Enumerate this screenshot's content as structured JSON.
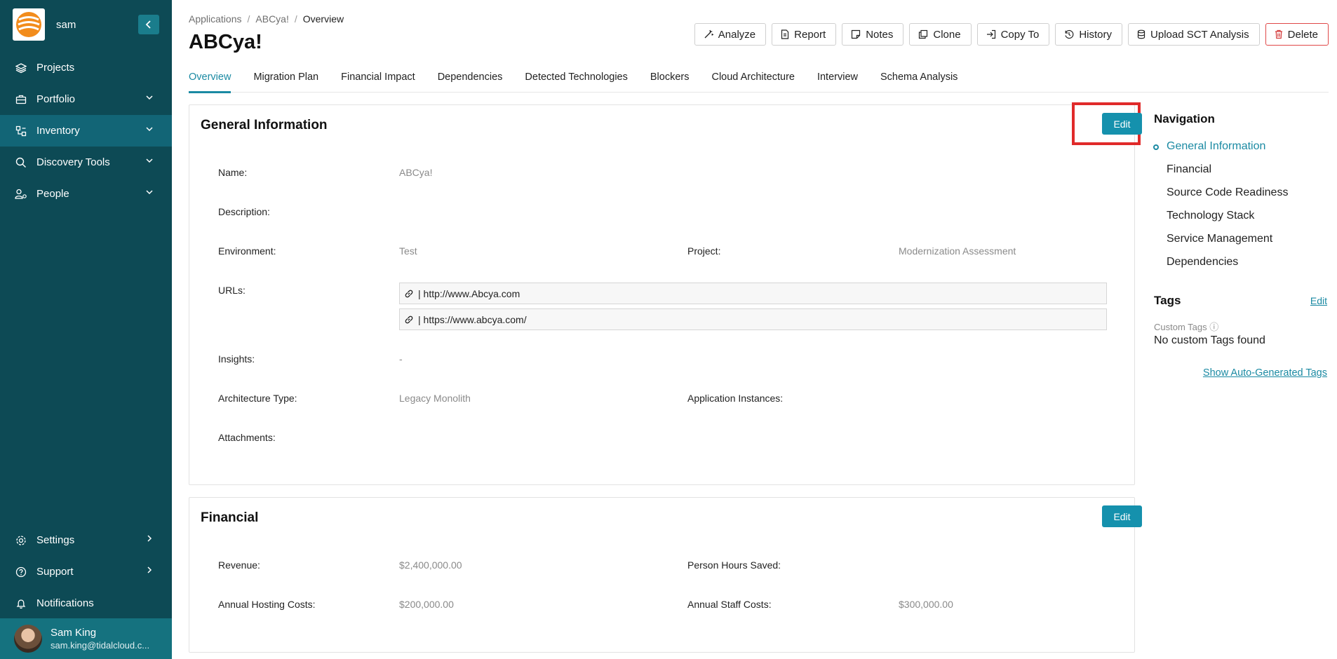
{
  "sidebar": {
    "user_short": "sam",
    "items": [
      {
        "label": "Projects",
        "icon": "layers-icon"
      },
      {
        "label": "Portfolio",
        "icon": "briefcase-icon"
      },
      {
        "label": "Inventory",
        "icon": "inventory-icon"
      },
      {
        "label": "Discovery Tools",
        "icon": "search-icon"
      },
      {
        "label": "People",
        "icon": "people-icon"
      }
    ],
    "bottom_items": [
      {
        "label": "Settings",
        "icon": "gear-icon"
      },
      {
        "label": "Support",
        "icon": "help-icon"
      },
      {
        "label": "Notifications",
        "icon": "bell-icon"
      }
    ],
    "user": {
      "name": "Sam King",
      "email": "sam.king@tidalcloud.c..."
    }
  },
  "breadcrumb": [
    "Applications",
    "ABCya!",
    "Overview"
  ],
  "page": {
    "title": "ABCya!"
  },
  "toolbar": [
    "Analyze",
    "Report",
    "Notes",
    "Clone",
    "Copy To",
    "History",
    "Upload SCT Analysis",
    "Delete"
  ],
  "tabs": [
    "Overview",
    "Migration Plan",
    "Financial Impact",
    "Dependencies",
    "Detected Technologies",
    "Blockers",
    "Cloud Architecture",
    "Interview",
    "Schema Analysis"
  ],
  "general": {
    "title": "General Information",
    "edit_label": "Edit",
    "name_label": "Name:",
    "name_value": "ABCya!",
    "description_label": "Description:",
    "environment_label": "Environment:",
    "environment_value": "Test",
    "project_label": "Project:",
    "project_value": "Modernization Assessment",
    "urls_label": "URLs:",
    "urls": [
      "| http://www.Abcya.com",
      "| https://www.abcya.com/"
    ],
    "insights_label": "Insights:",
    "insights_value": "-",
    "arch_label": "Architecture Type:",
    "arch_value": "Legacy Monolith",
    "instances_label": "Application Instances:",
    "attachments_label": "Attachments:"
  },
  "financial": {
    "title": "Financial",
    "edit_label": "Edit",
    "revenue_label": "Revenue:",
    "revenue_value": "$2,400,000.00",
    "hours_label": "Person Hours Saved:",
    "hosting_label": "Annual Hosting Costs:",
    "hosting_value": "$200,000.00",
    "staff_label": "Annual Staff Costs:",
    "staff_value": "$300,000.00"
  },
  "right_nav": {
    "title": "Navigation",
    "items": [
      "General Information",
      "Financial",
      "Source Code Readiness",
      "Technology Stack",
      "Service Management",
      "Dependencies"
    ]
  },
  "tags": {
    "title": "Tags",
    "edit_label": "Edit",
    "custom_label": "Custom Tags ⓘ",
    "empty_text": "No custom Tags found",
    "show_auto": "Show Auto-Generated Tags"
  },
  "colors": {
    "sidebar": "#0d4a55",
    "accent": "#1591ad",
    "highlight": "#e02a2a"
  }
}
